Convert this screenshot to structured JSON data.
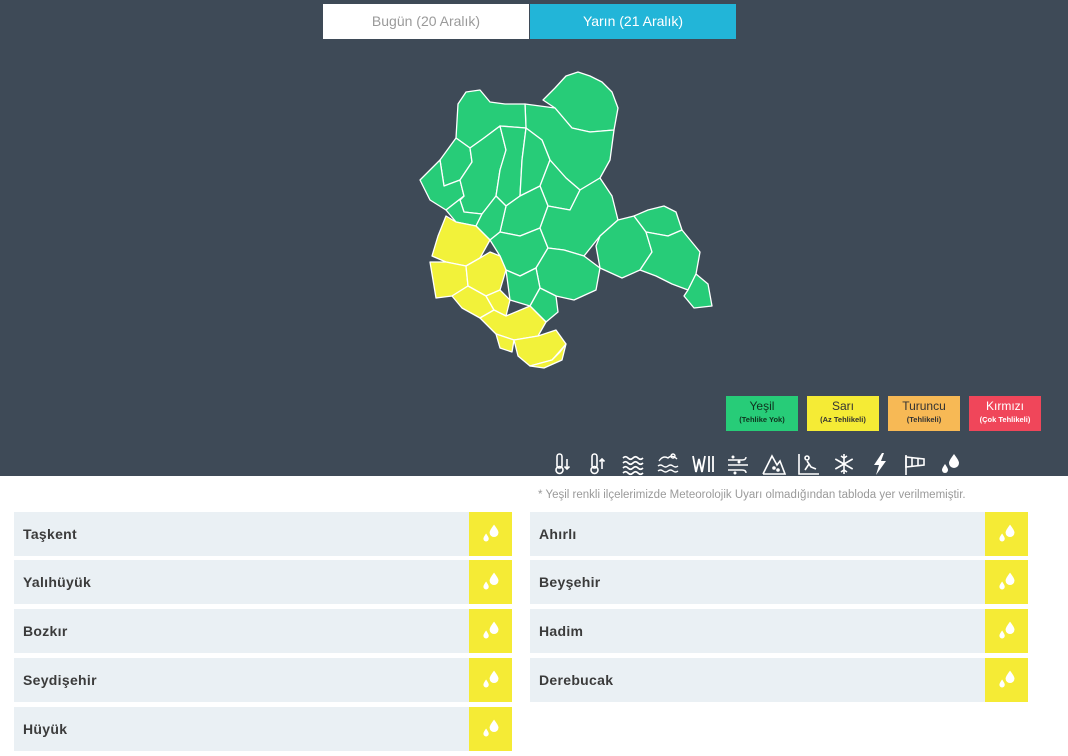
{
  "tabs": [
    {
      "label": "Bugün (20 Aralık)",
      "active": false
    },
    {
      "label": "Yarın (21 Aralık)",
      "active": true
    }
  ],
  "map": {
    "colors": {
      "none": "#27cc78",
      "yellow": "#f2f23a",
      "border": "#ffffff"
    },
    "yellow_districts": [
      "Taşkent",
      "Yalıhüyük",
      "Bozkır",
      "Seydişehir",
      "Hüyük",
      "Ahırlı",
      "Beyşehir",
      "Hadim",
      "Derebucak"
    ]
  },
  "legend": [
    {
      "name": "Yeşil",
      "desc": "(Tehlike Yok)",
      "color": "#27cc78"
    },
    {
      "name": "Sarı",
      "desc": "(Az Tehlikeli)",
      "color": "#f5eb35"
    },
    {
      "name": "Turuncu",
      "desc": "(Tehlikeli)",
      "color": "#f7b955"
    },
    {
      "name": "Kırmızı",
      "desc": "(Çok Tehlikeli)",
      "color": "#f0465a"
    }
  ],
  "hazards": [
    "cold-thermometer-icon",
    "hot-thermometer-icon",
    "fog-icon",
    "snow-melt-icon",
    "rain-icon",
    "dust-icon",
    "avalanche-icon",
    "slippery-icon",
    "snowflake-icon",
    "lightning-icon",
    "wind-icon",
    "raindrops-icon"
  ],
  "note": "* Yeşil renkli ilçelerimizde Meteorolojik Uyarı olmadığından tabloda yer verilmemiştir.",
  "districts_left": [
    "Taşkent",
    "Yalıhüyük",
    "Bozkır",
    "Seydişehir",
    "Hüyük"
  ],
  "districts_right": [
    "Ahırlı",
    "Beyşehir",
    "Hadim",
    "Derebucak"
  ],
  "warning_icon": "raindrops-icon",
  "warning_color": "#f5eb35"
}
